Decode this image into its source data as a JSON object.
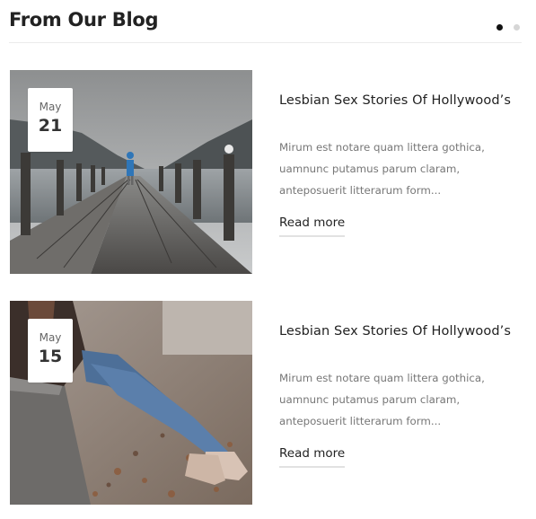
{
  "section": {
    "title": "From Our Blog",
    "pagination": {
      "total": 2,
      "active": 1
    }
  },
  "posts": [
    {
      "date": {
        "month": "May",
        "day": "21"
      },
      "title": "Lesbian Sex Stories Of Hollywood’s",
      "excerpt": "Mirum est notare quam littera gothica, uamnunc putamus parum claram, anteposuerit litterarum form...",
      "read_more": "Read more",
      "image": "person-on-pier-lake-photo"
    },
    {
      "date": {
        "month": "May",
        "day": "15"
      },
      "title": "Lesbian Sex Stories Of Hollywood’s",
      "excerpt": "Mirum est notare quam littera gothica, uamnunc putamus parum claram, anteposuerit litterarum form...",
      "read_more": "Read more",
      "image": "person-sitting-on-wall-autumn-leaves-photo"
    }
  ],
  "colors": {
    "text": "#222222",
    "muted": "#777777",
    "dot_active": "#111111",
    "dot_inactive": "#d6d6d6"
  }
}
